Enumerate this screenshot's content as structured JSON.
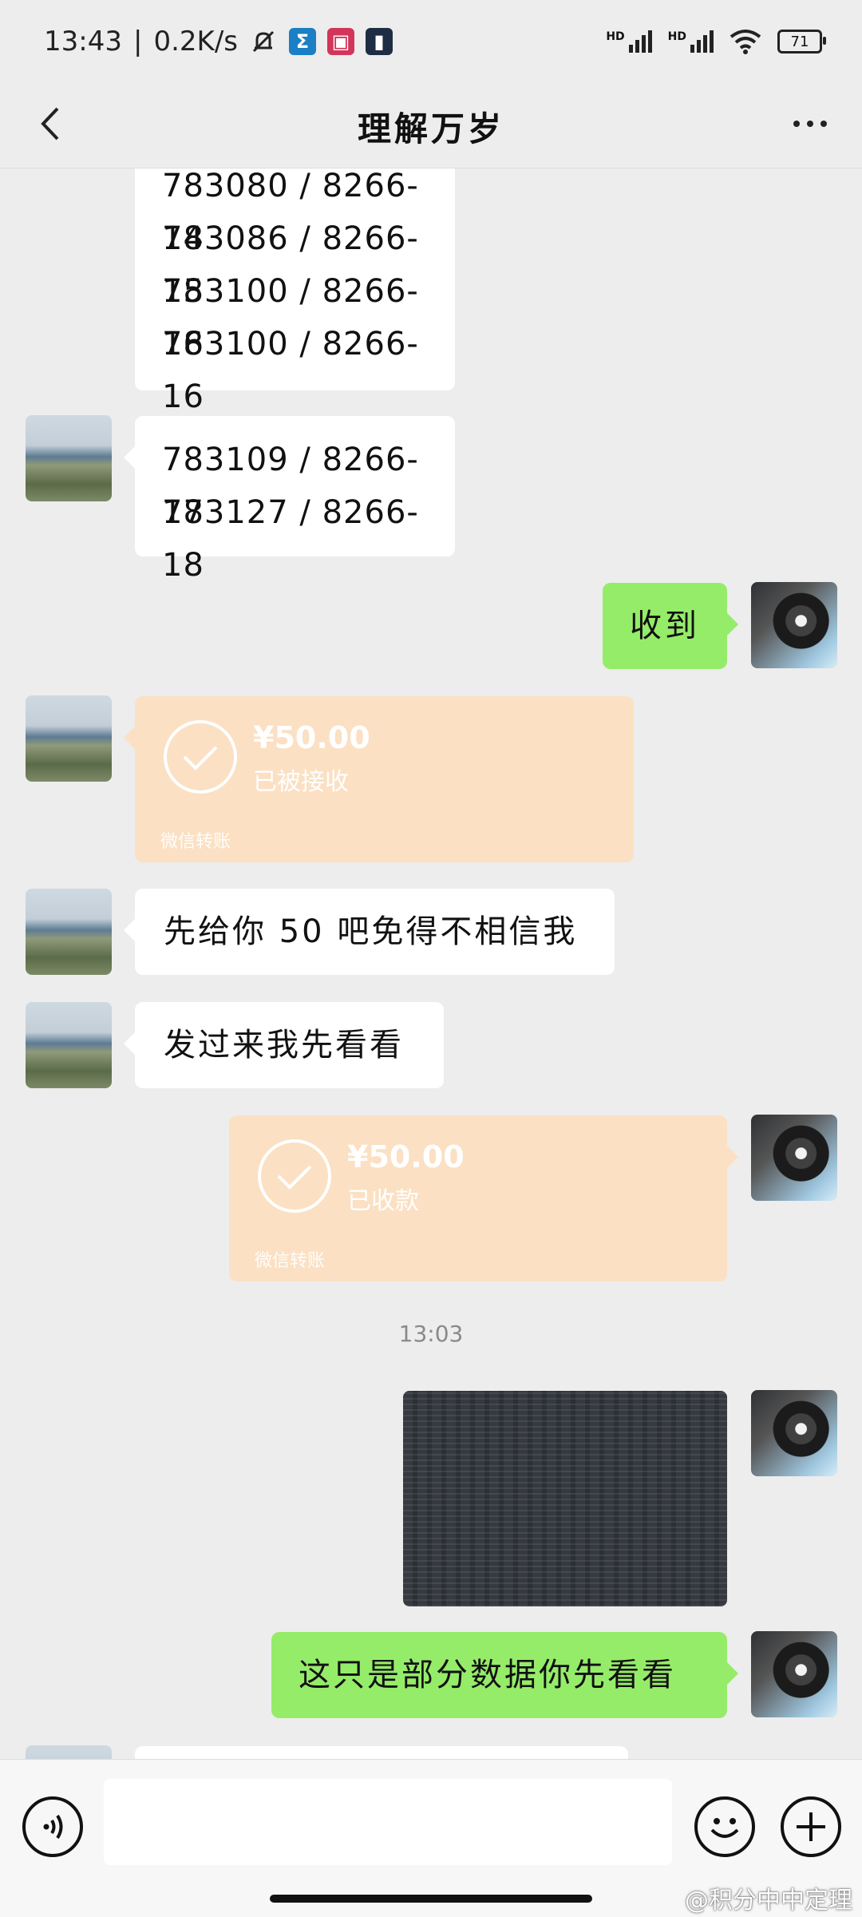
{
  "status_bar": {
    "time": "13:43",
    "separator": "|",
    "speed": "0.2K/s",
    "network1": "HD",
    "network2": "HD",
    "battery": "71"
  },
  "header": {
    "title": "理解万岁"
  },
  "messages": {
    "m1": {
      "lines": [
        "783080 / 8266-14",
        "783086 / 8266-15",
        "783100 / 8266-16",
        "783100 / 8266-16"
      ]
    },
    "m2": {
      "lines": [
        "783109 / 8266-17",
        "783127 / 8266-18"
      ]
    },
    "m3": {
      "text": "收到"
    },
    "m4": {
      "amount": "¥50.00",
      "status": "已被接收",
      "brand": "微信转账"
    },
    "m5": {
      "text": "先给你 50 吧免得不相信我"
    },
    "m6": {
      "text": "发过来我先看看"
    },
    "m7": {
      "amount": "¥50.00",
      "status": "已收款",
      "brand": "微信转账"
    },
    "time_divider": "13:03",
    "m9": {
      "text": "这只是部分数据你先看看"
    }
  },
  "input_bar": {
    "placeholder": ""
  },
  "watermark": "@积分中中定理",
  "colors": {
    "bubble_green": "#95ec69",
    "transfer": "#fbe0c3",
    "background": "#ededed"
  },
  "icons": {
    "back": "chevron-left-icon",
    "more": "more-dots-icon",
    "voice": "voice-icon",
    "emoji": "emoji-icon",
    "plus": "plus-icon",
    "check": "check-circle-icon"
  }
}
